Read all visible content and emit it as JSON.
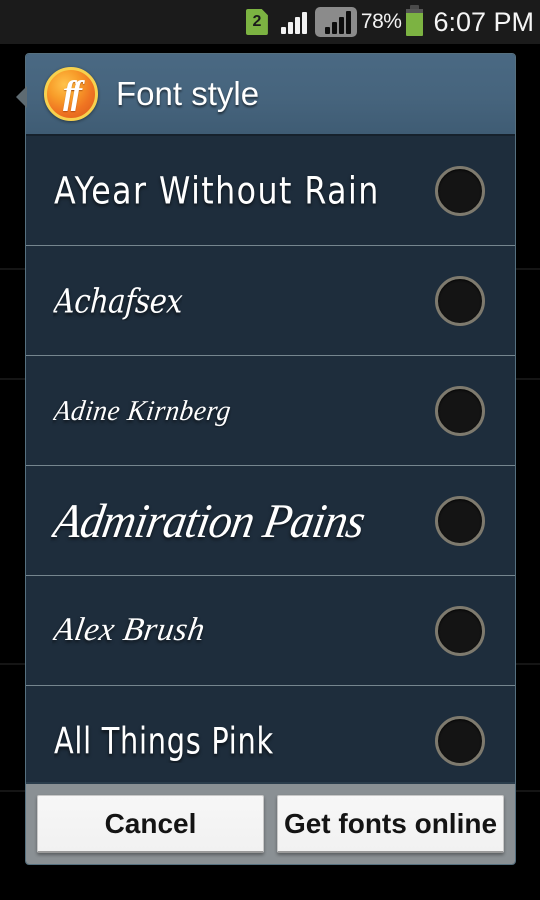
{
  "status_bar": {
    "sim_badge": "2",
    "signal_icon": "signal-bars-icon",
    "signal_icon_2": "signal-bars-boxed-icon",
    "battery_percent": "78%",
    "battery_icon": "battery-icon",
    "time": "6:07 PM"
  },
  "dialog": {
    "app_icon": "fontfix-ff-logo-icon",
    "app_icon_text": "ff",
    "title": "Font style",
    "fonts": [
      {
        "name": "AYear Without Rain",
        "style": "s-hand",
        "selected": false
      },
      {
        "name": "Achafsex",
        "style": "s-gothic",
        "selected": false
      },
      {
        "name": "Adine Kirnberg",
        "style": "s-script-thin",
        "selected": false
      },
      {
        "name": "Admiration Pains",
        "style": "s-swash",
        "selected": false
      },
      {
        "name": "Alex Brush",
        "style": "s-brush",
        "selected": false
      },
      {
        "name": "All Things Pink",
        "style": "s-casual",
        "selected": false
      }
    ],
    "footer": {
      "cancel_label": "Cancel",
      "get_fonts_label": "Get fonts online"
    }
  },
  "colors": {
    "dialog_body": "#1e2d3c",
    "dialog_header": "#46647d",
    "status_bar": "#1b1b1b",
    "accent_green": "#7cb342",
    "footer_bar": "#8a9094",
    "separator": "#76868f",
    "radio_ring": "#7e7a6e"
  }
}
